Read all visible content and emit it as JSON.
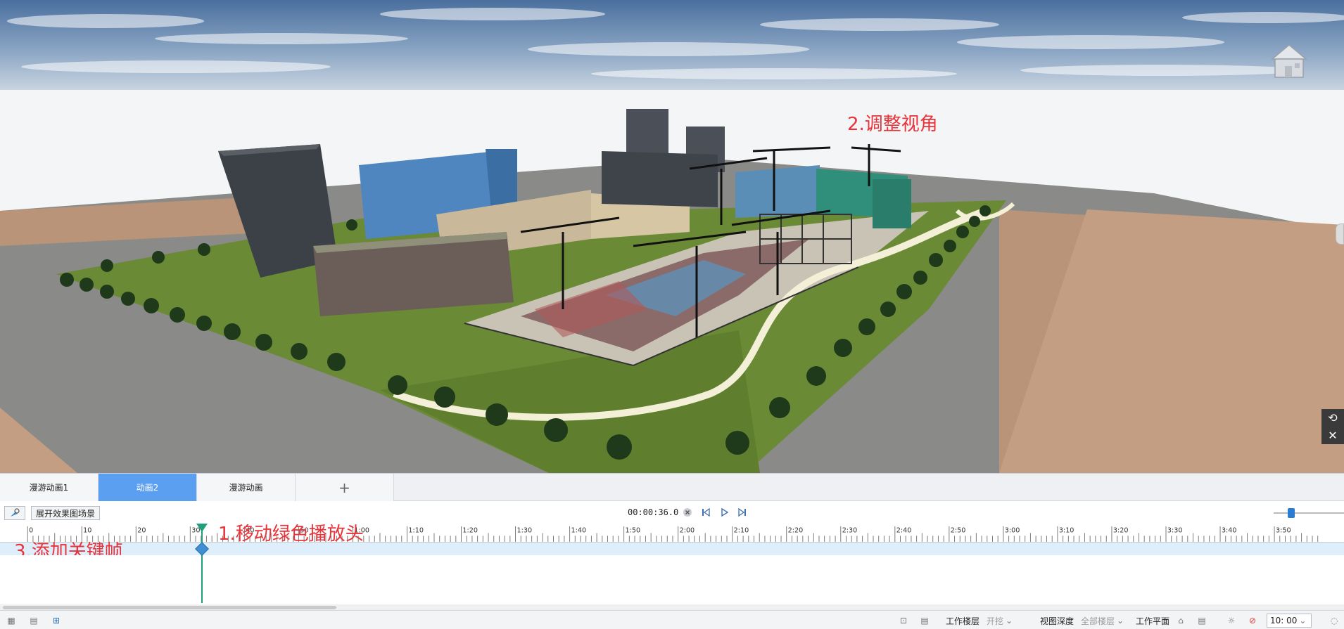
{
  "annotations": {
    "step1": "1.移动绿色播放头",
    "step2": "2.调整视角",
    "step3": "3.添加关键帧"
  },
  "viewport": {
    "viewcube_icon": "house-icon",
    "tools": [
      "reset-view-icon",
      "close-icon"
    ]
  },
  "tabs": [
    {
      "label": "漫游动画1",
      "active": false
    },
    {
      "label": "动画2",
      "active": true
    },
    {
      "label": "漫游动画",
      "active": false
    },
    {
      "label": "+",
      "active": false
    }
  ],
  "controls": {
    "add_camera_icon": "add-camera-icon",
    "expand_button": "展开效果图场景",
    "time": "00:00:36.0",
    "clear_icon": "clear-icon",
    "prev_icon": "previous-frame-icon",
    "play_icon": "play-icon",
    "next_icon": "next-frame-icon"
  },
  "ruler": {
    "labels": [
      "0",
      "10",
      "20",
      "30",
      "40",
      "50",
      "1:00",
      "1:10",
      "1:20",
      "1:30",
      "1:40",
      "1:50",
      "2:00",
      "2:10",
      "2:20",
      "2:30",
      "2:40",
      "2:50",
      "3:00",
      "3:10",
      "3:20",
      "3:30",
      "3:40",
      "3:50"
    ]
  },
  "playhead": {
    "time_seconds": 36
  },
  "statusbar": {
    "work_floor_label": "工作楼层",
    "work_floor_value": "开挖",
    "view_depth_label": "视图深度",
    "view_depth_value": "全部楼层",
    "work_plane_label": "工作平面",
    "zoom_value": "10: 00"
  },
  "colors": {
    "accent_tab": "#5b9ff0",
    "playhead": "#1fa07a",
    "keyframe": "#3f8fd2",
    "annotation": "#e8333a"
  }
}
